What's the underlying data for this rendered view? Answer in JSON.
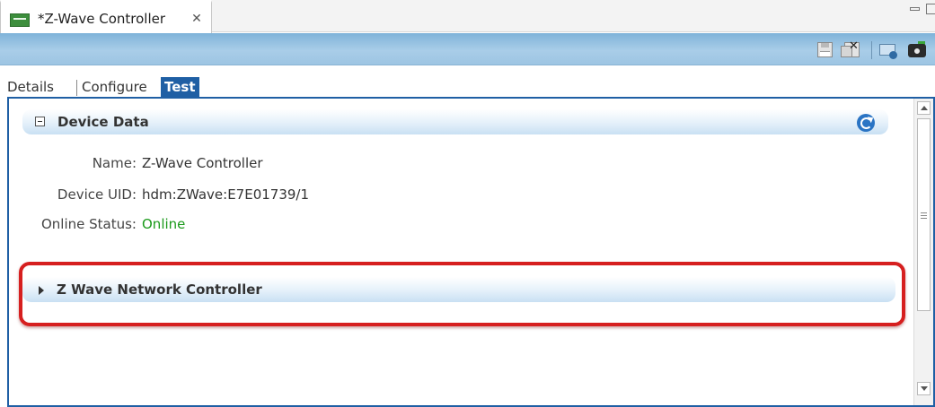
{
  "editor_tab": {
    "title": "*Z-Wave Controller",
    "close_glyph": "✕"
  },
  "toolbar": {
    "buttons": [
      "save-icon",
      "save-all-icon",
      "filter-icon",
      "camera-icon"
    ]
  },
  "subtabs": [
    {
      "label": "Details",
      "active": false
    },
    {
      "label": "Configure",
      "active": false
    },
    {
      "label": "Test",
      "active": true
    }
  ],
  "device_data": {
    "section_title": "Device Data",
    "fields": [
      {
        "label": "Name:",
        "value": "Z-Wave Controller"
      },
      {
        "label": "Device UID:",
        "value": "hdm:ZWave:E7E01739/1"
      },
      {
        "label": "Online Status:",
        "value": "Online"
      }
    ]
  },
  "network_controller": {
    "section_title": "Z Wave Network Controller",
    "expanded": false
  },
  "colors": {
    "accent": "#1f5fa4",
    "online": "#1a9a1a",
    "highlight": "#d61f1f"
  }
}
